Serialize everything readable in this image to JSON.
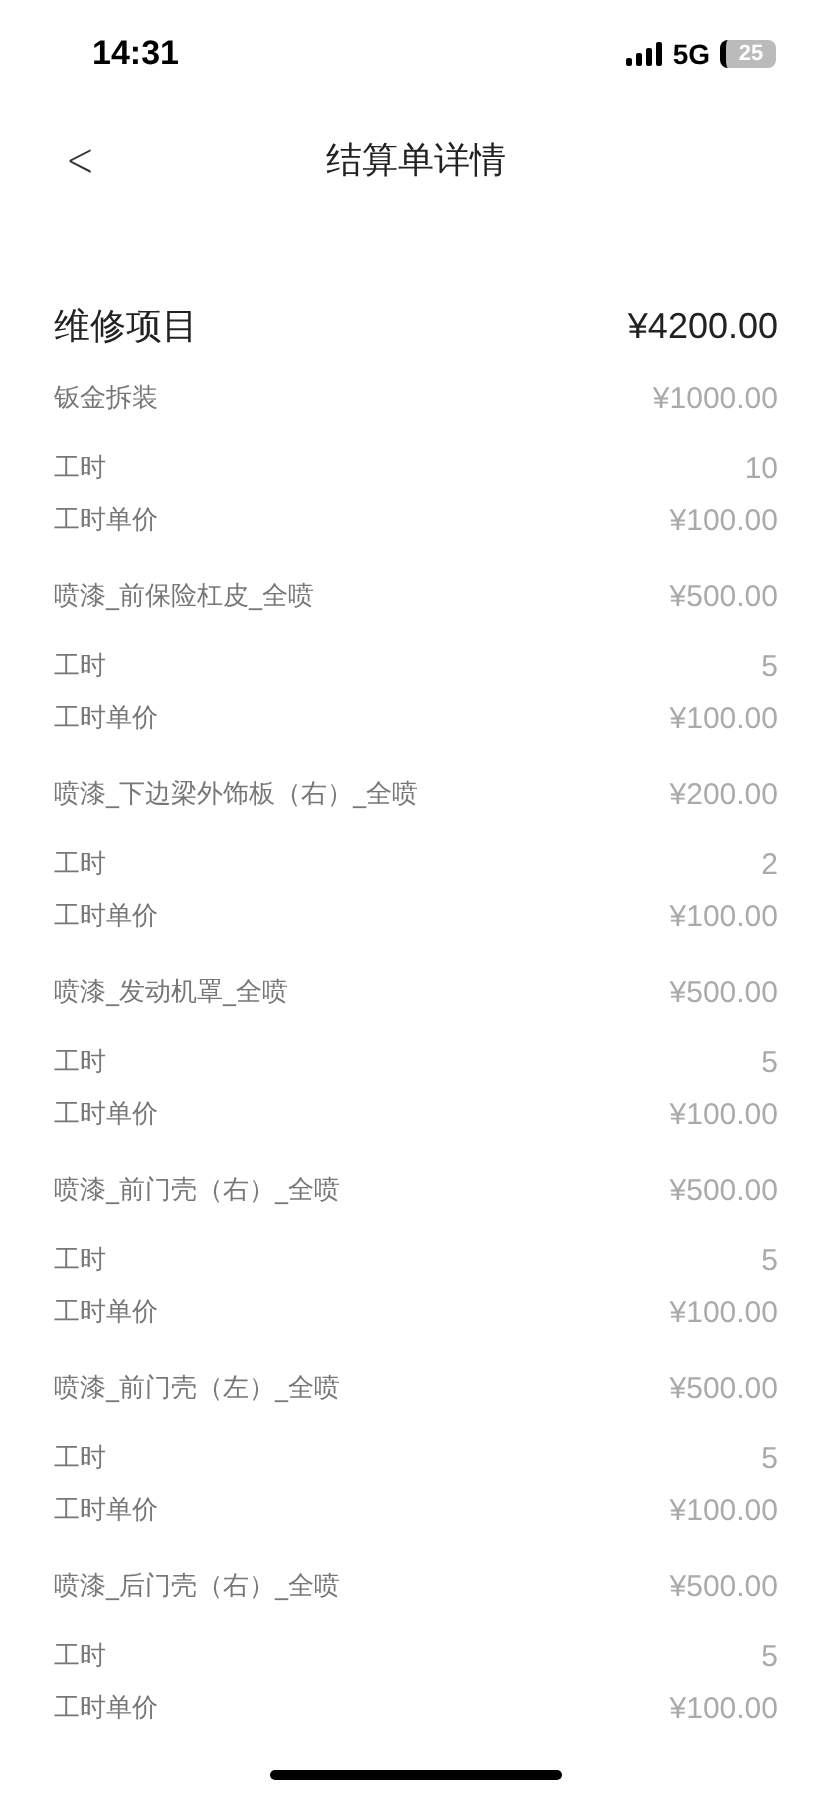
{
  "status_bar": {
    "time": "14:31",
    "network": "5G",
    "battery": "25"
  },
  "nav": {
    "back": "<",
    "title": "结算单详情"
  },
  "section": {
    "title": "维修项目",
    "total": "¥4200.00"
  },
  "items": [
    {
      "name": "钣金拆装",
      "price": "¥1000.00",
      "rows": [
        {
          "label": "工时",
          "value": "10"
        },
        {
          "label": "工时单价",
          "value": "¥100.00"
        }
      ]
    },
    {
      "name": "喷漆_前保险杠皮_全喷",
      "price": "¥500.00",
      "rows": [
        {
          "label": "工时",
          "value": "5"
        },
        {
          "label": "工时单价",
          "value": "¥100.00"
        }
      ]
    },
    {
      "name": "喷漆_下边梁外饰板（右）_全喷",
      "price": "¥200.00",
      "rows": [
        {
          "label": "工时",
          "value": "2"
        },
        {
          "label": "工时单价",
          "value": "¥100.00"
        }
      ]
    },
    {
      "name": "喷漆_发动机罩_全喷",
      "price": "¥500.00",
      "rows": [
        {
          "label": "工时",
          "value": "5"
        },
        {
          "label": "工时单价",
          "value": "¥100.00"
        }
      ]
    },
    {
      "name": "喷漆_前门壳（右）_全喷",
      "price": "¥500.00",
      "rows": [
        {
          "label": "工时",
          "value": "5"
        },
        {
          "label": "工时单价",
          "value": "¥100.00"
        }
      ]
    },
    {
      "name": "喷漆_前门壳（左）_全喷",
      "price": "¥500.00",
      "rows": [
        {
          "label": "工时",
          "value": "5"
        },
        {
          "label": "工时单价",
          "value": "¥100.00"
        }
      ]
    },
    {
      "name": "喷漆_后门壳（右）_全喷",
      "price": "¥500.00",
      "rows": [
        {
          "label": "工时",
          "value": "5"
        },
        {
          "label": "工时单价",
          "value": "¥100.00"
        }
      ]
    }
  ]
}
